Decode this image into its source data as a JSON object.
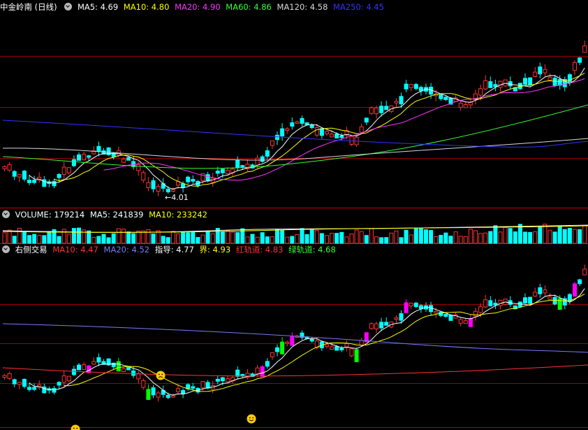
{
  "price_panel": {
    "title": "中金岭南 (日线)",
    "items": [
      {
        "label": "MA5: 4.69",
        "color": "#ffffff"
      },
      {
        "label": "MA10: 4.80",
        "color": "#ffff00"
      },
      {
        "label": "MA20: 4.90",
        "color": "#ff33ff"
      },
      {
        "label": "MA60: 4.86",
        "color": "#33ff33"
      },
      {
        "label": "MA120: 4.58",
        "color": "#d8d8d8"
      },
      {
        "label": "MA250: 4.45",
        "color": "#3333ff"
      }
    ],
    "low_marker": "4.01"
  },
  "volume_panel": {
    "items": [
      {
        "label": "VOLUME: 179214",
        "color": "#ffffff"
      },
      {
        "label": "MA5: 241839",
        "color": "#ffffff"
      },
      {
        "label": "MA10: 233242",
        "color": "#ffff00"
      }
    ]
  },
  "indicator_panel": {
    "title": "右侧交易",
    "items": [
      {
        "label": "MA10: 4.47",
        "color": "#ff3333"
      },
      {
        "label": "MA20: 4.52",
        "color": "#7a7aff"
      },
      {
        "label": "指导: 4.77",
        "color": "#ffffff"
      },
      {
        "label": "界: 4.93",
        "color": "#ffff00"
      },
      {
        "label": "红轨道: 4.83",
        "color": "#ff3333"
      },
      {
        "label": "绿轨道: 4.68",
        "color": "#33ff33"
      }
    ]
  },
  "colors": {
    "up": "#ff3232",
    "down": "#00ffff",
    "grid_sep": "#a00000",
    "magenta_bar": "#ff00ff",
    "green_bar": "#00ff00",
    "smiley": "#ffcc00"
  }
}
